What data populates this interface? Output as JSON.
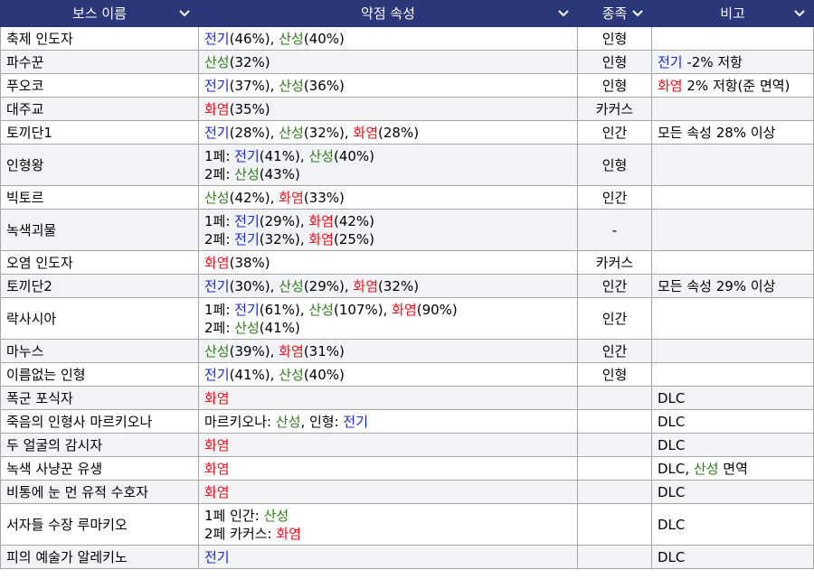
{
  "colors": {
    "header_bg": "#2b3778",
    "header_text": "#ffffff",
    "electric": "#1a2bc4",
    "acid": "#2d7d1c",
    "fire": "#e0141e",
    "row_alt": "#f2f3f7",
    "border": "#a6a6a6"
  },
  "columns": [
    "보스 이름",
    "약점 속성",
    "종족",
    "비고"
  ],
  "header_icon": "chevron-down-icon",
  "rows": [
    {
      "name": "축제 인도자",
      "weak": [
        [
          {
            "t": "전기",
            "c": "blue"
          },
          {
            "t": "(46%), "
          },
          {
            "t": "산성",
            "c": "green"
          },
          {
            "t": "(40%)"
          }
        ]
      ],
      "race": "인형",
      "note": []
    },
    {
      "name": "파수꾼",
      "weak": [
        [
          {
            "t": "산성",
            "c": "green"
          },
          {
            "t": "(32%)"
          }
        ]
      ],
      "race": "인형",
      "note": [
        {
          "t": "전기",
          "c": "blue"
        },
        {
          "t": " -2% 저항"
        }
      ]
    },
    {
      "name": "푸오코",
      "weak": [
        [
          {
            "t": "전기",
            "c": "blue"
          },
          {
            "t": "(37%), "
          },
          {
            "t": "산성",
            "c": "green"
          },
          {
            "t": "(36%)"
          }
        ]
      ],
      "race": "인형",
      "note": [
        {
          "t": "화염",
          "c": "red"
        },
        {
          "t": " 2% 저항(준 면역)"
        }
      ]
    },
    {
      "name": "대주교",
      "weak": [
        [
          {
            "t": "화염",
            "c": "red"
          },
          {
            "t": "(35%)"
          }
        ]
      ],
      "race": "카커스",
      "note": []
    },
    {
      "name": "토끼단1",
      "weak": [
        [
          {
            "t": "전기",
            "c": "blue"
          },
          {
            "t": "(28%), "
          },
          {
            "t": "산성",
            "c": "green"
          },
          {
            "t": "(32%), "
          },
          {
            "t": "화염",
            "c": "red"
          },
          {
            "t": "(28%)"
          }
        ]
      ],
      "race": "인간",
      "note": [
        {
          "t": "모든 속성 28% 이상"
        }
      ]
    },
    {
      "name": "인형왕",
      "weak": [
        [
          {
            "t": "1페: "
          },
          {
            "t": "전기",
            "c": "blue"
          },
          {
            "t": "(41%), "
          },
          {
            "t": "산성",
            "c": "green"
          },
          {
            "t": "(40%)"
          }
        ],
        [
          {
            "t": "2페: "
          },
          {
            "t": "산성",
            "c": "green"
          },
          {
            "t": "(43%)"
          }
        ]
      ],
      "race": "인형",
      "note": []
    },
    {
      "name": "빅토르",
      "weak": [
        [
          {
            "t": "산성",
            "c": "green"
          },
          {
            "t": "(42%), "
          },
          {
            "t": "화염",
            "c": "red"
          },
          {
            "t": "(33%)"
          }
        ]
      ],
      "race": "인간",
      "note": []
    },
    {
      "name": "녹색괴물",
      "weak": [
        [
          {
            "t": "1페: "
          },
          {
            "t": "전기",
            "c": "blue"
          },
          {
            "t": "(29%), "
          },
          {
            "t": "화염",
            "c": "red"
          },
          {
            "t": "(42%)"
          }
        ],
        [
          {
            "t": "2페: "
          },
          {
            "t": "전기",
            "c": "blue"
          },
          {
            "t": "(32%), "
          },
          {
            "t": "화염",
            "c": "red"
          },
          {
            "t": "(25%)"
          }
        ]
      ],
      "race": "-",
      "note": []
    },
    {
      "name": "오염 인도자",
      "weak": [
        [
          {
            "t": "화염",
            "c": "red"
          },
          {
            "t": "(38%)"
          }
        ]
      ],
      "race": "카커스",
      "note": []
    },
    {
      "name": "토끼단2",
      "weak": [
        [
          {
            "t": "전기",
            "c": "blue"
          },
          {
            "t": "(30%), "
          },
          {
            "t": "산성",
            "c": "green"
          },
          {
            "t": "(29%), "
          },
          {
            "t": "화염",
            "c": "red"
          },
          {
            "t": "(32%)"
          }
        ]
      ],
      "race": "인간",
      "note": [
        {
          "t": "모든 속성 29% 이상"
        }
      ]
    },
    {
      "name": "락사시아",
      "weak": [
        [
          {
            "t": "1페: "
          },
          {
            "t": "전기",
            "c": "blue"
          },
          {
            "t": "(61%), "
          },
          {
            "t": "산성",
            "c": "green"
          },
          {
            "t": "(107%), "
          },
          {
            "t": "화염",
            "c": "red"
          },
          {
            "t": "(90%)"
          }
        ],
        [
          {
            "t": "2페: "
          },
          {
            "t": "산성",
            "c": "green"
          },
          {
            "t": "(41%)"
          }
        ]
      ],
      "race": "인간",
      "note": []
    },
    {
      "name": "마누스",
      "weak": [
        [
          {
            "t": "산성",
            "c": "green"
          },
          {
            "t": "(39%), "
          },
          {
            "t": "화염",
            "c": "red"
          },
          {
            "t": "(31%)"
          }
        ]
      ],
      "race": "인간",
      "note": []
    },
    {
      "name": "이름없는 인형",
      "weak": [
        [
          {
            "t": "전기",
            "c": "blue"
          },
          {
            "t": "(41%), "
          },
          {
            "t": "산성",
            "c": "green"
          },
          {
            "t": "(40%)"
          }
        ]
      ],
      "race": "인형",
      "note": []
    },
    {
      "name": "폭군 포식자",
      "weak": [
        [
          {
            "t": "화염",
            "c": "red"
          }
        ]
      ],
      "race": "",
      "note": [
        {
          "t": "DLC"
        }
      ]
    },
    {
      "name": "죽음의 인형사 마르키오나",
      "weak": [
        [
          {
            "t": "마르키오나: "
          },
          {
            "t": "산성",
            "c": "green"
          },
          {
            "t": ", 인형: "
          },
          {
            "t": "전기",
            "c": "blue"
          }
        ]
      ],
      "race": "",
      "note": [
        {
          "t": "DLC"
        }
      ]
    },
    {
      "name": "두 얼굴의 감시자",
      "weak": [
        [
          {
            "t": "화염",
            "c": "red"
          }
        ]
      ],
      "race": "",
      "note": [
        {
          "t": "DLC"
        }
      ]
    },
    {
      "name": "녹색 사냥꾼 유생",
      "weak": [
        [
          {
            "t": "화염",
            "c": "red"
          }
        ]
      ],
      "race": "",
      "note": [
        {
          "t": "DLC, "
        },
        {
          "t": "산성",
          "c": "green"
        },
        {
          "t": " 면역"
        }
      ]
    },
    {
      "name": "비통에 눈 먼 유적 수호자",
      "weak": [
        [
          {
            "t": "화염",
            "c": "red"
          }
        ]
      ],
      "race": "",
      "note": [
        {
          "t": "DLC"
        }
      ]
    },
    {
      "name": "서자들 수장 루마키오",
      "weak": [
        [
          {
            "t": "1페 인간: "
          },
          {
            "t": "산성",
            "c": "green"
          }
        ],
        [
          {
            "t": "2페 카커스: "
          },
          {
            "t": "화염",
            "c": "red"
          }
        ]
      ],
      "race": "",
      "note": [
        {
          "t": "DLC"
        }
      ]
    },
    {
      "name": "피의 예술가 알레키노",
      "weak": [
        [
          {
            "t": "전기",
            "c": "blue"
          }
        ]
      ],
      "race": "",
      "note": [
        {
          "t": "DLC"
        }
      ]
    }
  ]
}
